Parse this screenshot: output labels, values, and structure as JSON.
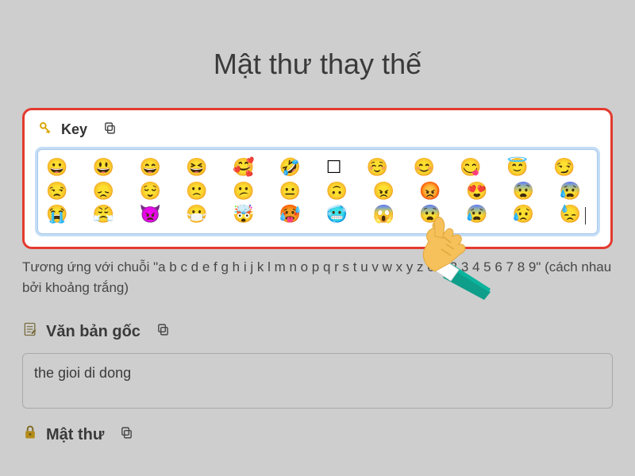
{
  "page": {
    "title": "Mật thư thay thế"
  },
  "key": {
    "label": "Key",
    "value": "😀 😃 😄 😆 🥰 🤣 ☐ ☺ 😊 😋 😇 😏 😒 😞 😌 🙁 😕 😐 🙃 😠 😡 😍 😨 😰 😭 😤 👿 😷 🤯 🥵 🥶 😱 😨 😰 😥 😓",
    "hint": "Tương ứng với chuỗi \"a b c d e f g h i j k l m n o p q r s t u v w x y z 0 1 2 3 4 5 6 7 8 9\" (cách nhau bởi khoảng trắng)"
  },
  "original": {
    "label": "Văn bản gốc",
    "value": "the gioi di dong"
  },
  "cipher": {
    "label": "Mật thư"
  }
}
